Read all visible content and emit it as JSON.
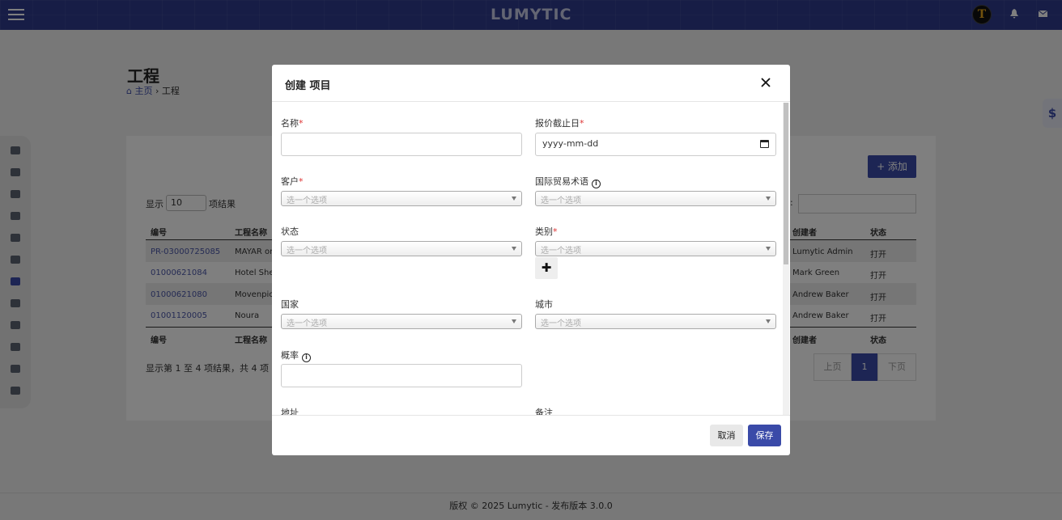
{
  "app": {
    "brand": "LUMYTIC",
    "avatar_letter": "T"
  },
  "page": {
    "title": "工程",
    "breadcrumb_home": "主页",
    "breadcrumb_sep": "›",
    "breadcrumb_current": "工程"
  },
  "toolbar": {
    "add_label": "+ 添加"
  },
  "table_controls": {
    "show_label": "显示",
    "page_size": "10",
    "results_label": "项结果",
    "search_colon": ":"
  },
  "table": {
    "headers_left": [
      "编号",
      "工程名称"
    ],
    "headers_right": [
      "创建者",
      "状态"
    ],
    "rows": [
      {
        "id": "PR-03000725085",
        "name": "MAYAR one",
        "creator": "Lumytic Admin",
        "status": "打开"
      },
      {
        "id": "01000621084",
        "name": "Hotel Shen",
        "creator": "Mark Green",
        "status": "打开"
      },
      {
        "id": "01000621080",
        "name": "Movenpick",
        "creator": "Andrew Baker",
        "status": "打开"
      },
      {
        "id": "01001120005",
        "name": "Noura",
        "creator": "Andrew Baker",
        "status": "打开"
      }
    ],
    "info": "显示第 1 至 4 项结果，共 4 项",
    "pager": {
      "prev": "上页",
      "current": "1",
      "next": "下页"
    }
  },
  "footer": {
    "text": "版权 © 2025 Lumytic - 发布版本 3.0.0"
  },
  "modal": {
    "title": "创建 项目",
    "fields": {
      "name_label": "名称",
      "deadline_label": "报价截止日",
      "deadline_placeholder": "yyyy-mm-dd",
      "customer_label": "客户",
      "incoterm_label": "国际贸易术语",
      "status_label": "状态",
      "category_label": "类别",
      "country_label": "国家",
      "city_label": "城市",
      "probability_label": "概率",
      "address_label": "地址",
      "notes_label": "备注",
      "select_placeholder": "选一个选项",
      "required_mark": "*",
      "plus": "✚"
    },
    "cancel_label": "取消",
    "save_label": "保存"
  }
}
